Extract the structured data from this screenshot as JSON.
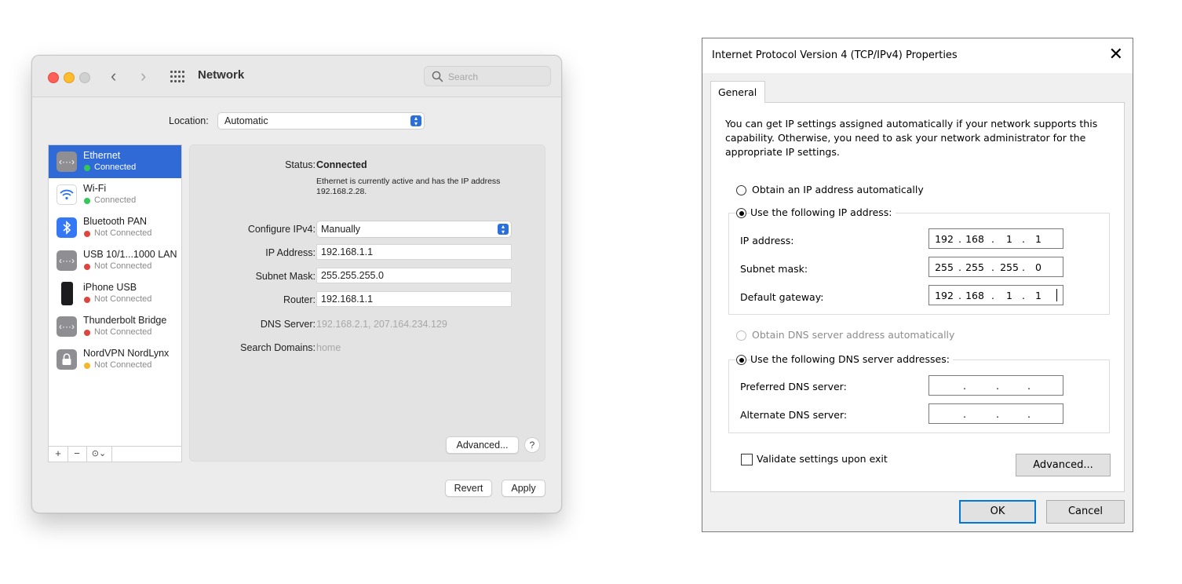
{
  "mac": {
    "title": "Network",
    "search_placeholder": "Search",
    "location_label": "Location:",
    "location_value": "Automatic",
    "sidebar": [
      {
        "name": "Ethernet",
        "status": "Connected",
        "status_color": "#34c759",
        "icon": "ethernet-icon",
        "icon_bg": "#8e8e93",
        "selected": true
      },
      {
        "name": "Wi-Fi",
        "status": "Connected",
        "status_color": "#34c759",
        "icon": "wifi-icon",
        "icon_bg": "#ffffff",
        "selected": false
      },
      {
        "name": "Bluetooth PAN",
        "status": "Not Connected",
        "status_color": "#e0443e",
        "icon": "bluetooth-icon",
        "icon_bg": "#3478f6",
        "selected": false
      },
      {
        "name": "USB 10/1...1000 LAN",
        "status": "Not Connected",
        "status_color": "#e0443e",
        "icon": "ethernet-icon",
        "icon_bg": "#8e8e93",
        "selected": false
      },
      {
        "name": "iPhone USB",
        "status": "Not Connected",
        "status_color": "#e0443e",
        "icon": "iphone-icon",
        "icon_bg": "#1c1c1e",
        "selected": false
      },
      {
        "name": "Thunderbolt Bridge",
        "status": "Not Connected",
        "status_color": "#e0443e",
        "icon": "ethernet-icon",
        "icon_bg": "#8e8e93",
        "selected": false
      },
      {
        "name": "NordVPN NordLynx",
        "status": "Not Connected",
        "status_color": "#f5b72a",
        "icon": "lock-icon",
        "icon_bg": "#8e8e93",
        "selected": false
      }
    ],
    "sidebar_buttons": {
      "add": "+",
      "remove": "−",
      "action": "⊙⌄"
    },
    "panel": {
      "status_label": "Status:",
      "status_value": "Connected",
      "status_desc": "Ethernet is currently active and has the IP address 192.168.2.28.",
      "configure_label": "Configure IPv4:",
      "configure_value": "Manually",
      "ip_label": "IP Address:",
      "ip_value": "192.168.1.1",
      "subnet_label": "Subnet Mask:",
      "subnet_value": "255.255.255.0",
      "router_label": "Router:",
      "router_value": "192.168.1.1",
      "dns_label": "DNS Server:",
      "dns_value": "192.168.2.1, 207.164.234.129",
      "search_domains_label": "Search Domains:",
      "search_domains_value": "home",
      "advanced": "Advanced...",
      "help": "?"
    },
    "revert": "Revert",
    "apply": "Apply"
  },
  "win": {
    "title": "Internet Protocol Version 4 (TCP/IPv4) Properties",
    "close": "✕",
    "tab": "General",
    "intro": "You can get IP settings assigned automatically if your network supports this capability. Otherwise, you need to ask your network administrator for the appropriate IP settings.",
    "obtain_ip_auto": "Obtain an IP address automatically",
    "use_following_ip": "Use the following IP address:",
    "ip_address_label": "IP address:",
    "ip_address": [
      "192",
      "168",
      "1",
      "1"
    ],
    "subnet_label": "Subnet mask:",
    "subnet": [
      "255",
      "255",
      "255",
      "0"
    ],
    "gateway_label": "Default gateway:",
    "gateway": [
      "192",
      "168",
      "1",
      "1"
    ],
    "obtain_dns_auto": "Obtain DNS server address automatically",
    "use_following_dns": "Use the following DNS server addresses:",
    "preferred_dns_label": "Preferred DNS server:",
    "alternate_dns_label": "Alternate DNS server:",
    "validate_label": "Validate settings upon exit",
    "validate_checked": false,
    "advanced": "Advanced...",
    "ok": "OK",
    "cancel": "Cancel"
  }
}
